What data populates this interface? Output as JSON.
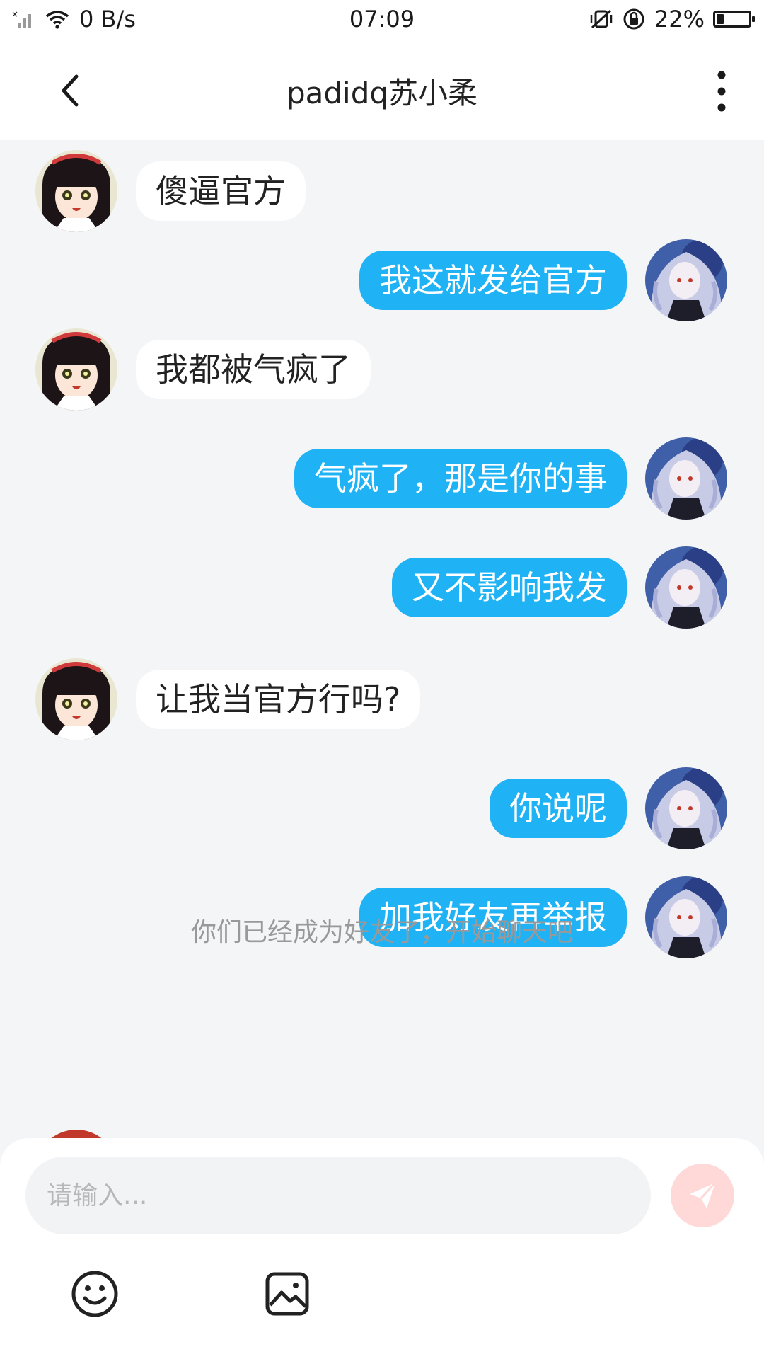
{
  "status_bar": {
    "network_speed": "0 B/s",
    "time": "07:09",
    "battery": "22%",
    "battery_level": 0.22
  },
  "header": {
    "title": "padidq苏小柔"
  },
  "messages": [
    {
      "side": "in",
      "text": "傻逼官方"
    },
    {
      "side": "out",
      "text": "我这就发给官方"
    },
    {
      "side": "in",
      "text": "我都被气疯了"
    },
    {
      "side": "out",
      "text": "气疯了，那是你的事"
    },
    {
      "side": "out",
      "text": "又不影响我发"
    },
    {
      "side": "in",
      "text": "让我当官方行吗?"
    },
    {
      "side": "out",
      "text": "你说呢"
    },
    {
      "side": "out",
      "text": "加我好友再举报"
    }
  ],
  "system_message": "你们已经成为好友了，开始聊天吧",
  "composer": {
    "placeholder": "请输入..."
  },
  "colors": {
    "accent": "#1fb3f5",
    "send_button": "#ffd8d8",
    "background": "#f4f5f7"
  }
}
